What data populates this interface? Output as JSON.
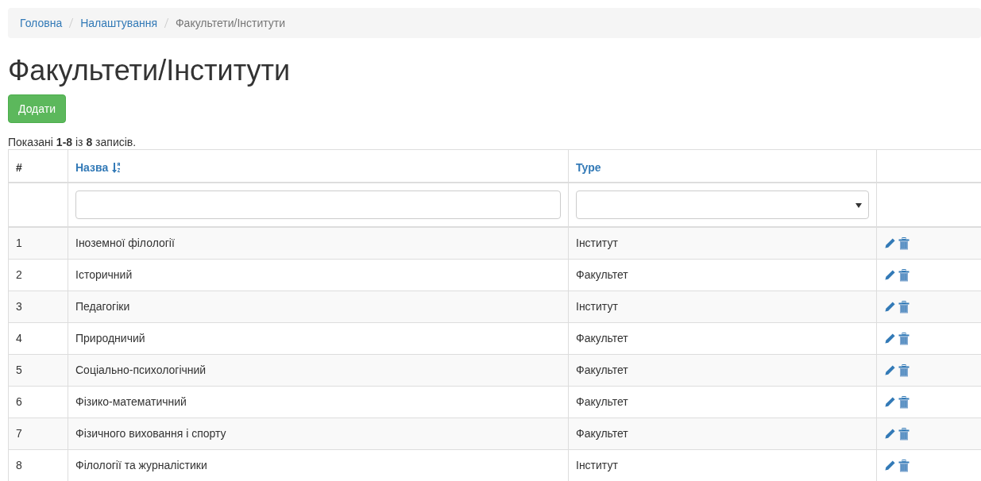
{
  "breadcrumb": [
    {
      "label": "Головна",
      "kind": "link"
    },
    {
      "label": "Налаштування",
      "kind": "link"
    },
    {
      "label": "Факультети/Інститути",
      "kind": "current"
    }
  ],
  "title": "Факультети/Інститути",
  "add_button": "Додати",
  "summary": "Показані **1-8** із **8** записів.",
  "table": {
    "columns": [
      {
        "label": "#",
        "kind": "plain"
      },
      {
        "label": "Назва",
        "kind": "sorted"
      },
      {
        "label": "Type",
        "kind": "link"
      },
      {
        "kind": "actions"
      }
    ],
    "filters": [
      {
        "kind": "none"
      },
      {
        "kind": "text"
      },
      {
        "kind": "select"
      },
      {
        "kind": "none"
      }
    ],
    "rows": [
      {
        "num": "1",
        "name": "Іноземної філології",
        "type": "Інститут"
      },
      {
        "num": "2",
        "name": "Історичний",
        "type": "Факультет"
      },
      {
        "num": "3",
        "name": "Педагогіки",
        "type": "Інститут"
      },
      {
        "num": "4",
        "name": "Природничий",
        "type": "Факультет"
      },
      {
        "num": "5",
        "name": "Соціально-психологічний",
        "type": "Факультет"
      },
      {
        "num": "6",
        "name": "Фізико-математичний",
        "type": "Факультет"
      },
      {
        "num": "7",
        "name": "Фізичного виховання і спорту",
        "type": "Факультет"
      },
      {
        "num": "8",
        "name": "Філології та журналістики",
        "type": "Інститут"
      }
    ]
  }
}
